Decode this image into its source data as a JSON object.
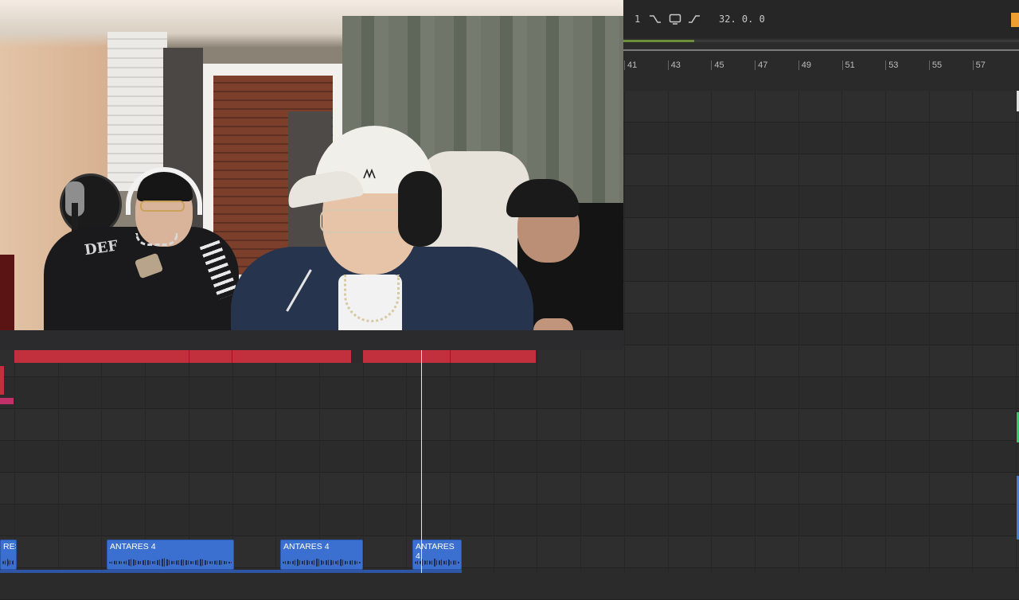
{
  "transport": {
    "bar_value": "1",
    "position": "32.  0.  0",
    "icons": [
      "fade-out-icon",
      "loop-icon",
      "fade-in-icon"
    ],
    "progress": 0.18
  },
  "ruler": {
    "bars": [
      "41",
      "43",
      "45",
      "47",
      "49",
      "51",
      "53",
      "55",
      "57"
    ]
  },
  "clips": [
    {
      "label": "RES"
    },
    {
      "label": "ANTARES 4"
    },
    {
      "label": "ANTARES 4"
    },
    {
      "label": "ANTARES 4"
    }
  ],
  "colors": {
    "background": "#2c2c2c",
    "red_clip": "#c22f3d",
    "blue_clip": "#3b6fd0",
    "accent_orange": "#f0a030",
    "green_marker": "#3ec26e"
  },
  "webcam": {
    "hoodie_text": "DEF"
  }
}
